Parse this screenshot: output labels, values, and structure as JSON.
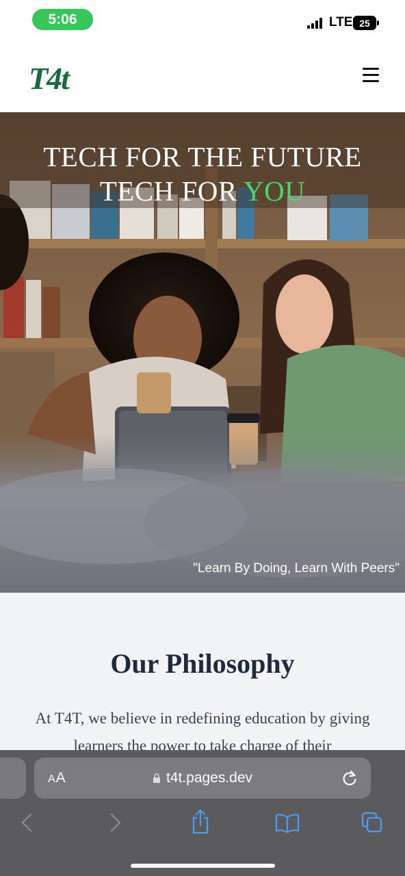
{
  "status_bar": {
    "time": "5:06",
    "network": "LTE",
    "battery": "25",
    "time_pill_color": "#34c759"
  },
  "header": {
    "logo_text": "T4t",
    "logo_color": "#176b3a",
    "menu_icon": "hamburger-menu-icon"
  },
  "hero": {
    "title_line1": "TECH FOR THE FUTURE",
    "title_line2_prefix": "TECH FOR",
    "title_line2_accent": "YOU",
    "accent_color": "#4ad66d",
    "quote": "\"Learn By Doing, Learn With Peers\""
  },
  "philosophy": {
    "title": "Our Philosophy",
    "text": "At T4T, we believe in redefining education by giving learners the power to take charge of their"
  },
  "browser": {
    "text_size_label_big": "A",
    "text_size_label_small": "A",
    "url": "t4t.pages.dev",
    "accent_color": "#4a9ef5"
  }
}
